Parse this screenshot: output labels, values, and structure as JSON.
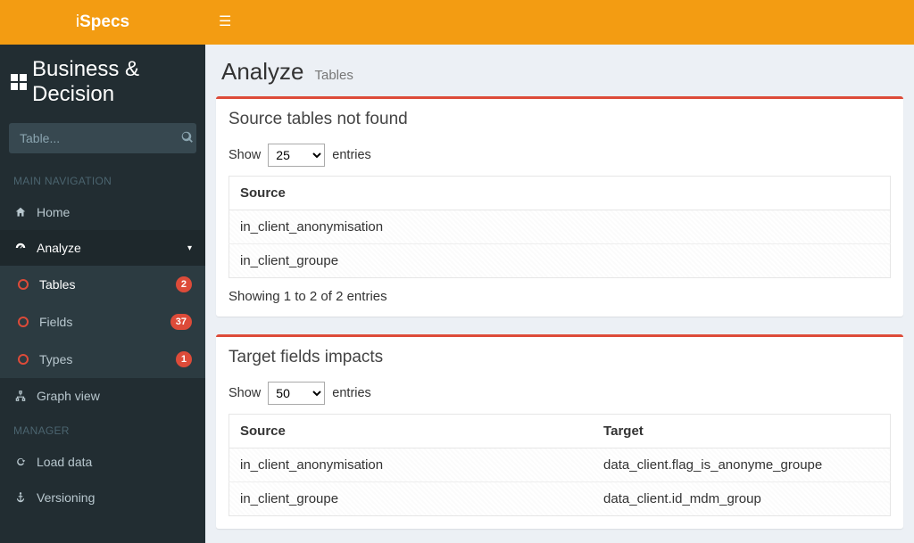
{
  "topbar": {
    "logo_prefix": "i",
    "logo_bold": "Specs"
  },
  "brand": {
    "text": "Business & Decision"
  },
  "search": {
    "placeholder": "Table..."
  },
  "nav": {
    "header_main": "MAIN NAVIGATION",
    "home": "Home",
    "analyze": "Analyze",
    "sub": {
      "tables": {
        "label": "Tables",
        "badge": "2"
      },
      "fields": {
        "label": "Fields",
        "badge": "37"
      },
      "types": {
        "label": "Types",
        "badge": "1"
      }
    },
    "graph": "Graph view",
    "header_manager": "MANAGER",
    "load": "Load data",
    "versioning": "Versioning"
  },
  "page": {
    "title": "Analyze",
    "subtitle": "Tables"
  },
  "box1": {
    "title": "Source tables not found",
    "show_label": "Show",
    "entries_label": "entries",
    "page_size": "25",
    "col_source": "Source",
    "rows": [
      {
        "source": "in_client_anonymisation"
      },
      {
        "source": "in_client_groupe"
      }
    ],
    "info": "Showing 1 to 2 of 2 entries"
  },
  "box2": {
    "title": "Target fields impacts",
    "show_label": "Show",
    "entries_label": "entries",
    "page_size": "50",
    "col_source": "Source",
    "col_target": "Target",
    "rows": [
      {
        "source": "in_client_anonymisation",
        "target": "data_client.flag_is_anonyme_groupe"
      },
      {
        "source": "in_client_groupe",
        "target": "data_client.id_mdm_group"
      }
    ]
  }
}
